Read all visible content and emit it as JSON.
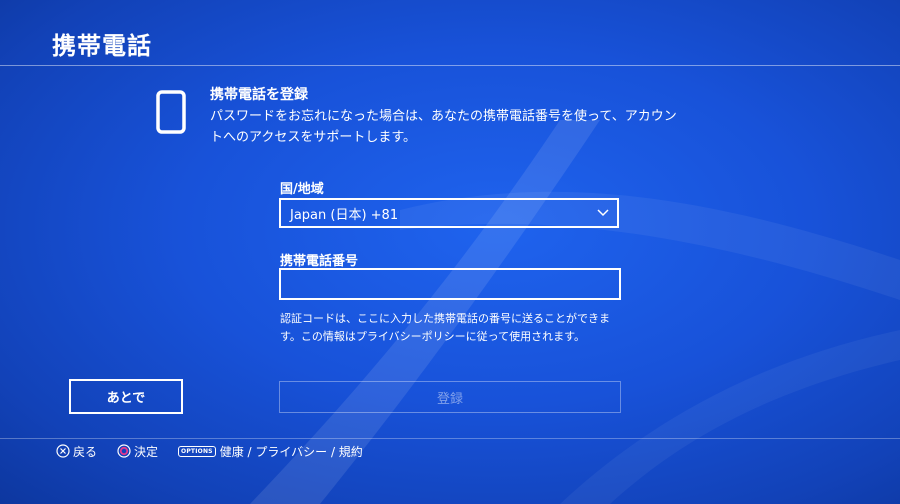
{
  "header": {
    "title": "携帯電話"
  },
  "intro": {
    "icon": "smartphone-icon",
    "heading": "携帯電話を登録",
    "description": "パスワードをお忘れになった場合は、あなたの携帯電話番号を使って、アカウントへのアクセスをサポートします。"
  },
  "form": {
    "country_label": "国/地域",
    "country_value": "Japan (日本) +81",
    "phone_label": "携帯電話番号",
    "phone_value": "",
    "help_text": "認証コードは、ここに入力した携帯電話の番号に送ることができます。この情報はプライバシーポリシーに従って使用されます。"
  },
  "buttons": {
    "later_label": "あとで",
    "register_label": "登録"
  },
  "footer": {
    "back_label": "戻る",
    "confirm_label": "決定",
    "options_badge": "OPTIONS",
    "options_label": "健康 / プライバシー / 規約"
  },
  "colors": {
    "background": "#1852d9",
    "text": "#ffffff",
    "circle_button": "#e0388f"
  }
}
